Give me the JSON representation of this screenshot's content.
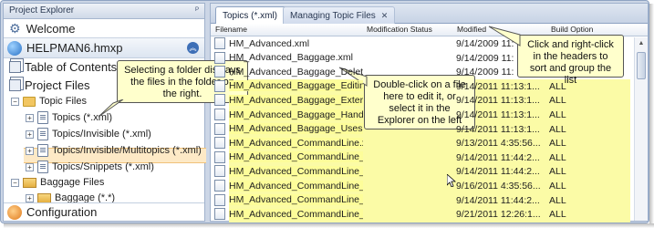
{
  "left_panel": {
    "header": "Project Explorer",
    "pin": "ᴾ",
    "welcome": "Welcome",
    "project_name": "HELPMAN6.hmxp",
    "toc": "Table of Contents",
    "project_files": "Project Files",
    "topic_files": "Topic Files",
    "folders": [
      "Topics (*.xml)",
      "Topics/Invisible (*.xml)",
      "Topics/Invisible/Multitopics (*.xml)",
      "Topics/Snippets (*.xml)"
    ],
    "baggage_files": "Baggage Files",
    "baggage": "Baggage (*.*)",
    "configuration": "Configuration"
  },
  "tabs": [
    {
      "label": "Topics (*.xml)",
      "close": "✕"
    },
    {
      "label": "Managing Topic Files",
      "close": "✕"
    }
  ],
  "columns": [
    "Filename",
    "Modification Status",
    "Modified",
    "Build Option"
  ],
  "rows": [
    {
      "name": "HM_Advanced.xml",
      "date": "9/14/2009 11:",
      "build": ""
    },
    {
      "name": "HM_Advanced_Baggage.xml",
      "date": "9/14/2009 11:",
      "build": ""
    },
    {
      "name": "HM_Advanced_Baggage_Delete...",
      "date": "9/14/2009 11:",
      "build": ""
    },
    {
      "name": "HM_Advanced_Baggage_Editin...",
      "date": "9/14/2011 11:13:1...",
      "build": "ALL"
    },
    {
      "name": "HM_Advanced_Baggage_Extern...",
      "date": "9/14/2011 11:13:1...",
      "build": "ALL"
    },
    {
      "name": "HM_Advanced_Baggage_Handli...",
      "date": "9/14/2011 11:13:1...",
      "build": "ALL"
    },
    {
      "name": "HM_Advanced_Baggage_Uses....",
      "date": "9/14/2011 11:13:1...",
      "build": "ALL"
    },
    {
      "name": "HM_Advanced_CommandLine.xml",
      "date": "9/13/2011 4:35:56...",
      "build": "ALL"
    },
    {
      "name": "HM_Advanced_CommandLine_...",
      "date": "9/14/2011 11:44:2...",
      "build": "ALL"
    },
    {
      "name": "HM_Advanced_CommandLine_...",
      "date": "9/14/2011 11:44:2...",
      "build": "ALL"
    },
    {
      "name": "HM_Advanced_CommandLine_...",
      "date": "9/16/2011 4:35:56...",
      "build": "ALL"
    },
    {
      "name": "HM_Advanced_CommandLine_I...",
      "date": "9/14/2011 11:44:2...",
      "build": "ALL"
    },
    {
      "name": "HM_Advanced_CommandLine_I...",
      "date": "9/21/2011 12:26:1...",
      "build": "ALL"
    },
    {
      "name": "HM_Advanced_CommandLine_I...",
      "date": "9/14/2011 11:44:2...",
      "build": "ALL"
    }
  ],
  "callouts": {
    "folder": "Selecting a folder displays the files in the folder on the right.",
    "headers": "Click and right-click in the headers to sort and group the list",
    "file": "Double-click on a file here to edit it, or select it in the Explorer on the left"
  },
  "colors": {
    "highlight": "#fbfba6",
    "selection": "#fde9c6",
    "callout_bg": "#ffffcc",
    "panel_border": "#9fb1cc"
  },
  "icons": [
    "gear-icon",
    "project-icon",
    "folder-icon",
    "document-icon",
    "pin-icon",
    "close-icon",
    "configuration-icon"
  ]
}
